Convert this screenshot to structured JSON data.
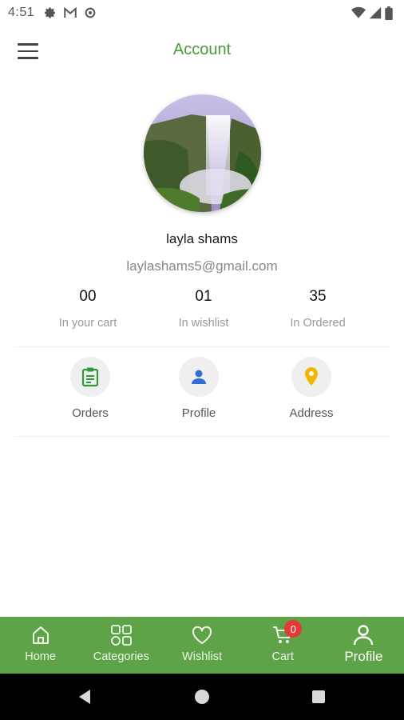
{
  "status_bar": {
    "time": "4:51",
    "icons_left": [
      "settings-icon",
      "gmail-icon",
      "settings-icon"
    ],
    "icons_right": [
      "wifi-icon",
      "signal-icon",
      "battery-icon"
    ]
  },
  "header": {
    "title": "Account",
    "menu_icon": "hamburger-menu-icon"
  },
  "profile": {
    "name": "layla shams",
    "email": "laylashams5@gmail.com",
    "avatar": "waterfall-photo"
  },
  "stats": [
    {
      "value": "00",
      "label": "In your cart"
    },
    {
      "value": "01",
      "label": "In wishlist"
    },
    {
      "value": "35",
      "label": "In Ordered"
    }
  ],
  "shortcuts": [
    {
      "label": "Orders",
      "icon": "clipboard-icon",
      "color": "#2e9b3a"
    },
    {
      "label": "Profile",
      "icon": "person-icon",
      "color": "#2f6fd6"
    },
    {
      "label": "Address",
      "icon": "location-pin-icon",
      "color": "#f5b400"
    }
  ],
  "bottom_nav": {
    "items": [
      {
        "label": "Home",
        "icon": "home-icon"
      },
      {
        "label": "Categories",
        "icon": "categories-icon"
      },
      {
        "label": "Wishlist",
        "icon": "heart-icon"
      },
      {
        "label": "Cart",
        "icon": "cart-icon",
        "badge": "0"
      },
      {
        "label": "Profile",
        "icon": "profile-icon",
        "active": true
      }
    ],
    "bg_color": "#5ea347"
  },
  "colors": {
    "accent": "#4a9a37",
    "badge": "#e53935"
  }
}
